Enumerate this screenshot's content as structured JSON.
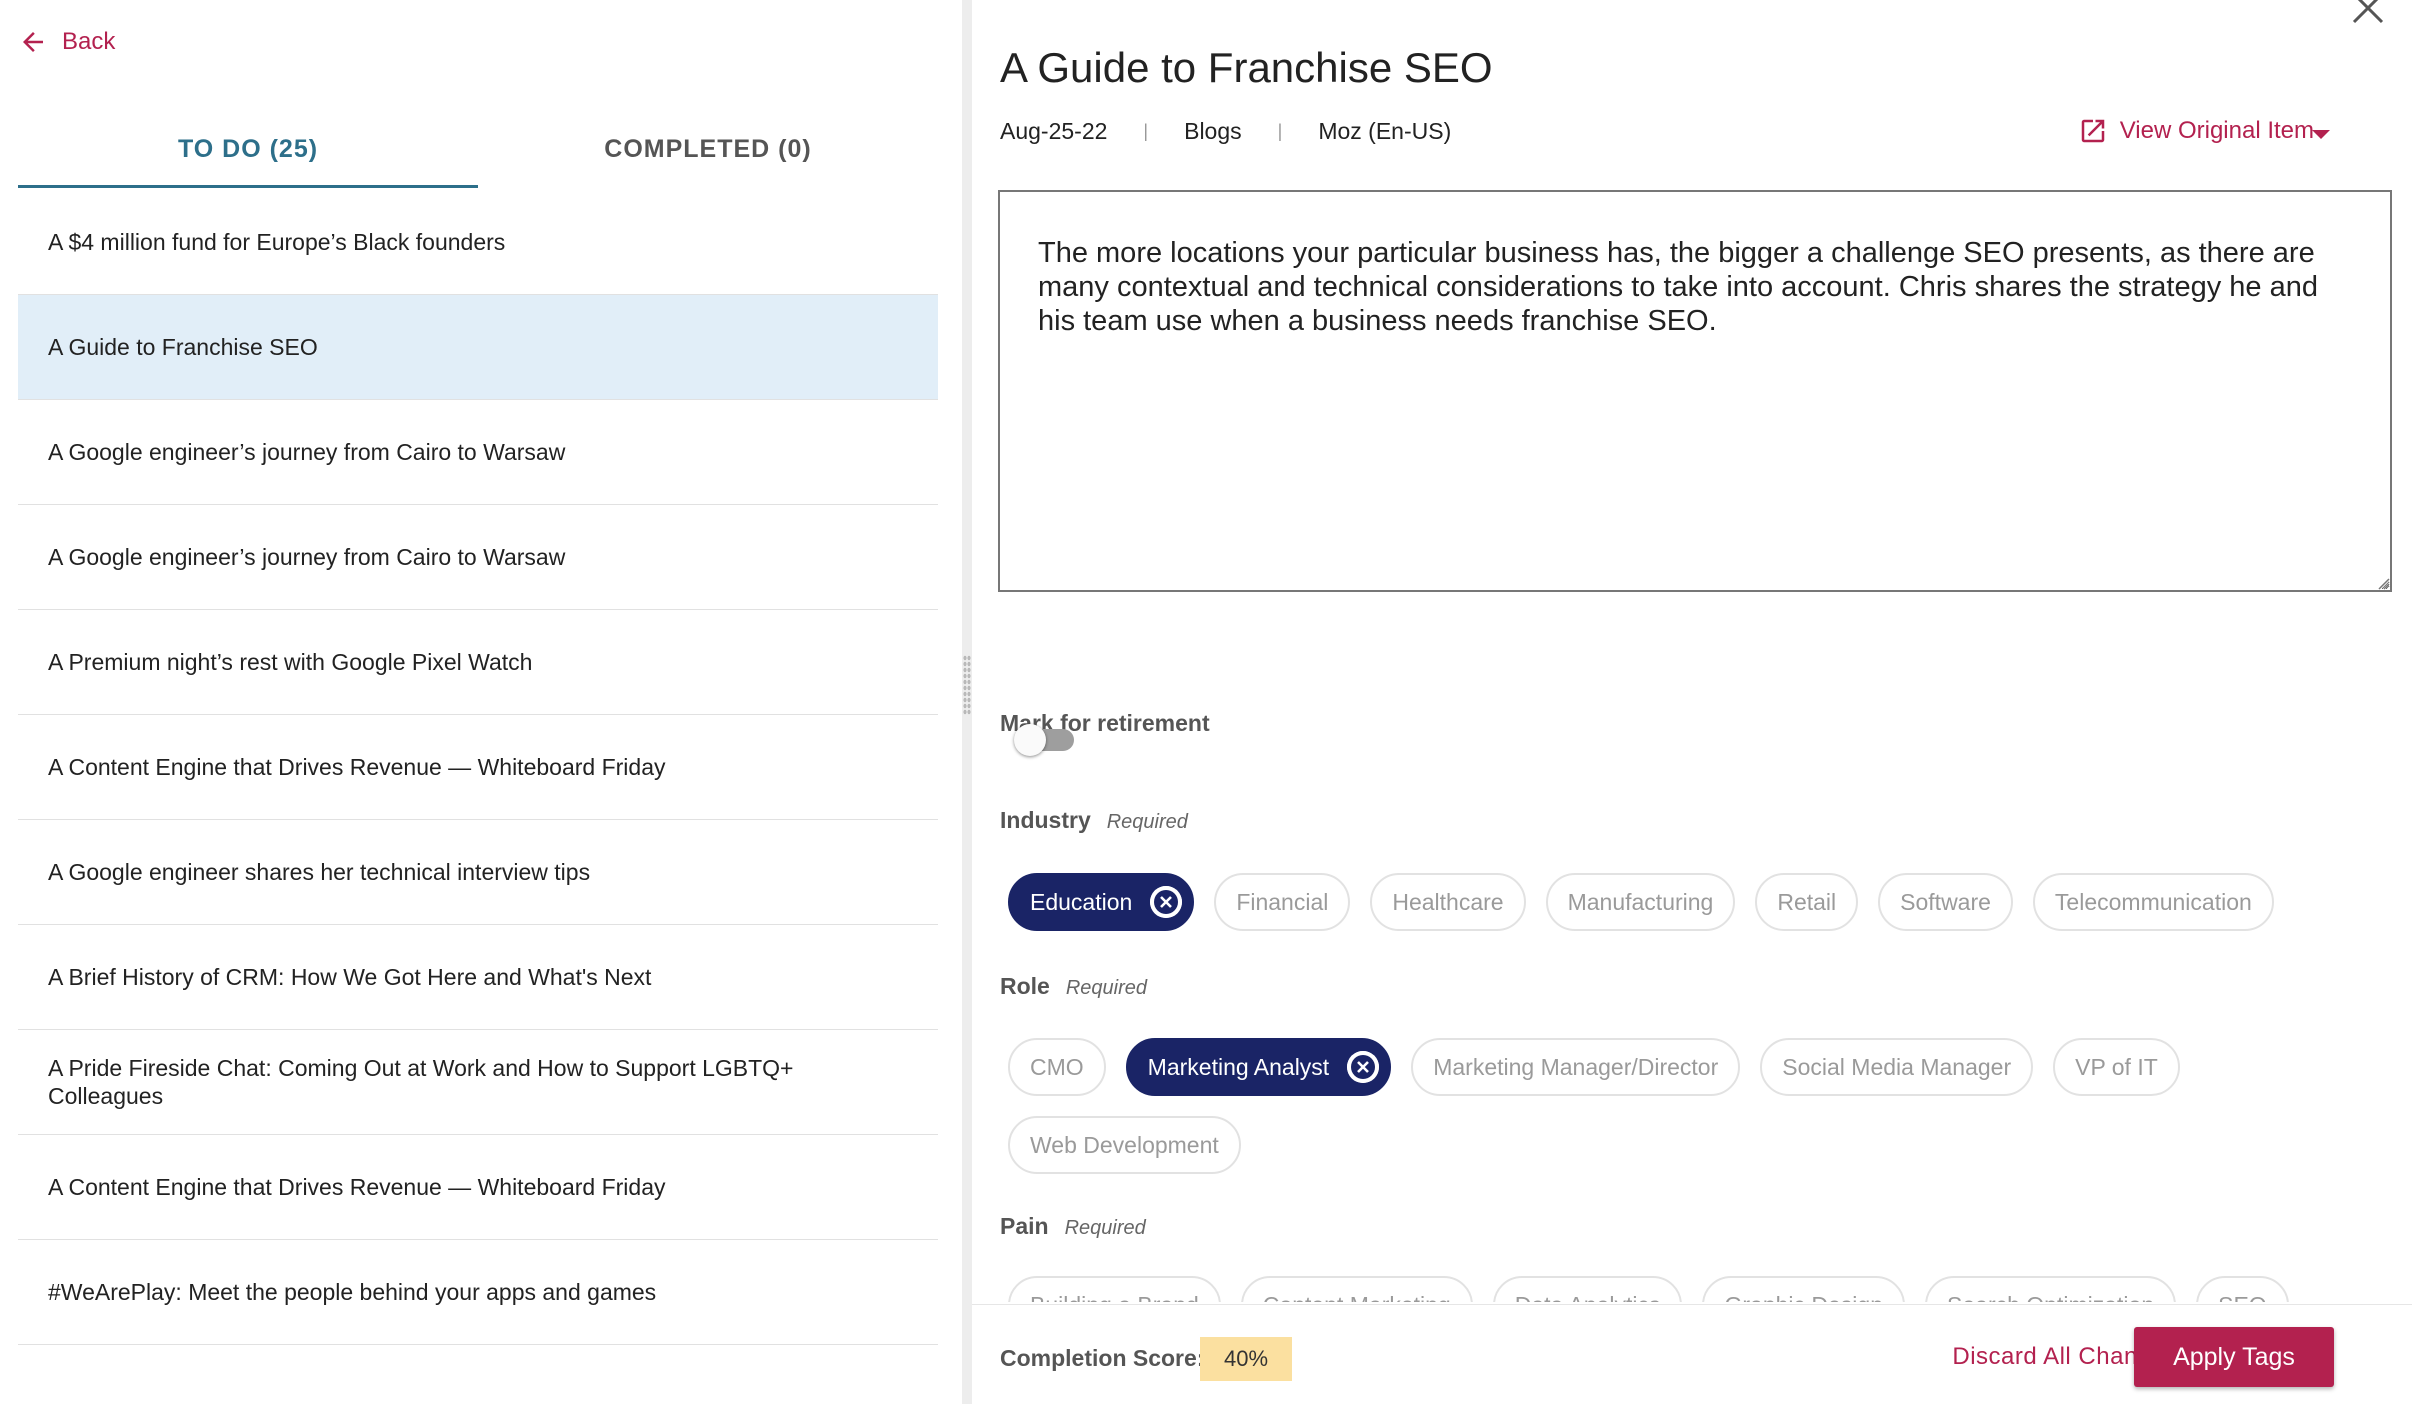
{
  "nav": {
    "back_label": "Back"
  },
  "tabs": [
    {
      "label": "TO DO (25)",
      "active": true
    },
    {
      "label": "COMPLETED (0)",
      "active": false
    }
  ],
  "items": [
    {
      "title": "A $4 million fund for Europe’s Black founders"
    },
    {
      "title": "A Guide to Franchise SEO",
      "selected": true
    },
    {
      "title": "A Google engineer’s journey from Cairo to Warsaw"
    },
    {
      "title": "A Google engineer’s journey from Cairo to Warsaw"
    },
    {
      "title": "A Premium night’s rest with Google Pixel Watch"
    },
    {
      "title": "A Content Engine that Drives Revenue — Whiteboard Friday"
    },
    {
      "title": "A Google engineer shares her technical interview tips"
    },
    {
      "title": "A Brief History of CRM: How We Got Here and What's Next"
    },
    {
      "title": "A Pride Fireside Chat: Coming Out at Work and How to Support LGBTQ+ Colleagues"
    },
    {
      "title": "A Content Engine that Drives Revenue — Whiteboard Friday"
    },
    {
      "title": "#WeArePlay: Meet the people behind your apps and games"
    }
  ],
  "detail": {
    "title": "A Guide to Franchise SEO",
    "date": "Aug-25-22",
    "type": "Blogs",
    "source": "Moz (En-US)",
    "view_original_label": "View Original Item",
    "description": "The more locations your particular business has, the bigger a challenge SEO presents, as there are many contextual and technical considerations to take into account. Chris shares the strategy he and his team use when a business needs franchise SEO.",
    "retire_label": "Mark for retirement",
    "retire_on": false,
    "required_label": "Required"
  },
  "industry": {
    "label": "Industry",
    "options": [
      {
        "label": "Education",
        "selected": true
      },
      {
        "label": "Financial",
        "selected": false
      },
      {
        "label": "Healthcare",
        "selected": false
      },
      {
        "label": "Manufacturing",
        "selected": false
      },
      {
        "label": "Retail",
        "selected": false
      },
      {
        "label": "Software",
        "selected": false
      },
      {
        "label": "Telecommunication",
        "selected": false
      }
    ]
  },
  "role": {
    "label": "Role",
    "options": [
      {
        "label": "CMO",
        "selected": false
      },
      {
        "label": "Marketing Analyst",
        "selected": true
      },
      {
        "label": "Marketing Manager/Director",
        "selected": false
      },
      {
        "label": "Social Media Manager",
        "selected": false
      },
      {
        "label": "VP of IT",
        "selected": false
      },
      {
        "label": "Web Development",
        "selected": false
      }
    ]
  },
  "pain": {
    "label": "Pain",
    "options": [
      {
        "label": "Building a Brand",
        "selected": false
      },
      {
        "label": "Content Marketing",
        "selected": false
      },
      {
        "label": "Data Analytics",
        "selected": false
      },
      {
        "label": "Graphic Design",
        "selected": false
      },
      {
        "label": "Search Optimization",
        "selected": false
      },
      {
        "label": "SEO",
        "selected": false
      }
    ]
  },
  "footer": {
    "score_label": "Completion Score:",
    "score_value": "40%",
    "discard_label": "Discard All Changes",
    "apply_label": "Apply Tags"
  },
  "colors": {
    "accent": "#b3214f",
    "tab_active": "#2d6f8a",
    "chip_selected": "#1a2466",
    "selected_row": "#e1eef8",
    "score_bg": "#fbe0a0"
  }
}
